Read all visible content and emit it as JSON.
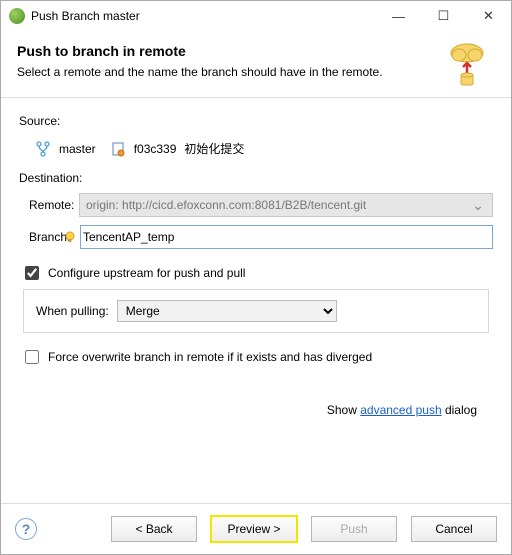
{
  "window": {
    "title": "Push Branch master"
  },
  "header": {
    "title": "Push to branch in remote",
    "subtitle": "Select a remote and the name the branch should have in the remote."
  },
  "source": {
    "label": "Source:",
    "branch": "master",
    "commit_hash": "f03c339",
    "commit_msg": "初始化提交"
  },
  "destination": {
    "label": "Destination:",
    "remote_label": "Remote:",
    "remote_value": "origin: http://cicd.efoxconn.com:8081/B2B/tencent.git",
    "branch_label": "Branch:",
    "branch_value": "TencentAP_temp"
  },
  "options": {
    "configure_upstream": "Configure upstream for push and pull",
    "when_pulling_label": "When pulling:",
    "when_pulling_value": "Merge",
    "force_overwrite": "Force overwrite branch in remote if it exists and has diverged"
  },
  "advanced": {
    "prefix": "Show ",
    "link": "advanced push",
    "suffix": " dialog"
  },
  "buttons": {
    "back": "< Back",
    "preview": "Preview >",
    "push": "Push",
    "cancel": "Cancel"
  }
}
